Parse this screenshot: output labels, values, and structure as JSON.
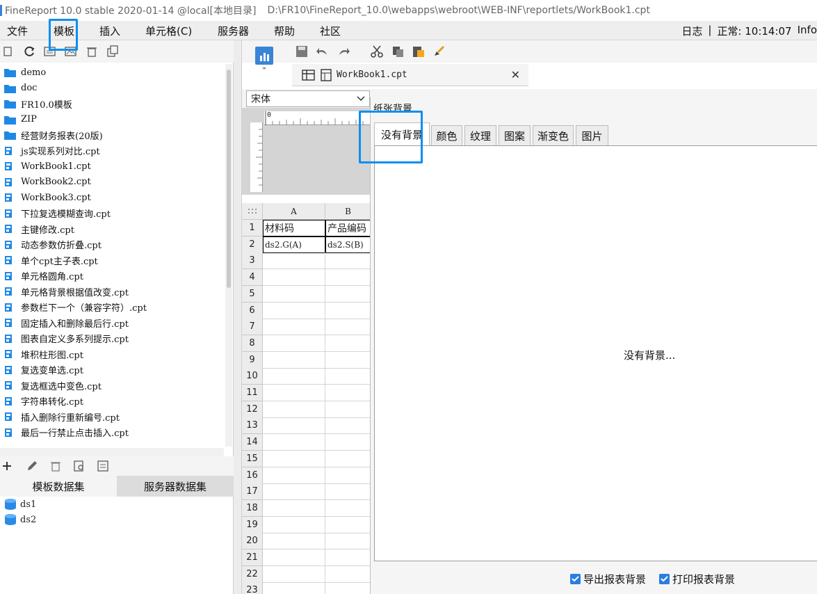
{
  "window": {
    "title": "FineReport 10.0 stable 2020-01-14 @local[本地目录]",
    "path": "D:\\FR10\\FineReport_10.0\\webapps\\webroot\\WEB-INF\\reportlets/WorkBook1.cpt"
  },
  "menu": {
    "items": [
      "文件",
      "模板",
      "插入",
      "单元格(C)",
      "服务器",
      "帮助",
      "社区"
    ],
    "status": [
      "日志",
      "|",
      "正常: 10:14:07",
      "Info"
    ]
  },
  "file_tree": {
    "items": [
      {
        "label": "demo",
        "type": "folder"
      },
      {
        "label": "doc",
        "type": "folder"
      },
      {
        "label": "FR10.0模板",
        "type": "folder"
      },
      {
        "label": "ZIP",
        "type": "folder"
      },
      {
        "label": "经营财务报表(20版)",
        "type": "folder"
      },
      {
        "label": "js实现系列对比.cpt",
        "type": "file"
      },
      {
        "label": "WorkBook1.cpt",
        "type": "file"
      },
      {
        "label": "WorkBook2.cpt",
        "type": "file"
      },
      {
        "label": "WorkBook3.cpt",
        "type": "file"
      },
      {
        "label": "下拉复选模糊查询.cpt",
        "type": "file"
      },
      {
        "label": "主键修改.cpt",
        "type": "file"
      },
      {
        "label": "动态参数仿折叠.cpt",
        "type": "file"
      },
      {
        "label": "单个cpt主子表.cpt",
        "type": "file"
      },
      {
        "label": "单元格圆角.cpt",
        "type": "file"
      },
      {
        "label": "单元格背景根据值改变.cpt",
        "type": "file"
      },
      {
        "label": "参数栏下一个（兼容字符）.cpt",
        "type": "file"
      },
      {
        "label": "固定插入和删除最后行.cpt",
        "type": "file"
      },
      {
        "label": "图表自定义多系列提示.cpt",
        "type": "file"
      },
      {
        "label": "堆积柱形图.cpt",
        "type": "file"
      },
      {
        "label": "复选变单选.cpt",
        "type": "file"
      },
      {
        "label": "复选框选中变色.cpt",
        "type": "file"
      },
      {
        "label": "字符串转化.cpt",
        "type": "file"
      },
      {
        "label": "插入删除行重新编号.cpt",
        "type": "file"
      },
      {
        "label": "最后一行禁止点击插入.cpt",
        "type": "file"
      }
    ]
  },
  "datasets": {
    "tabs": [
      "模板数据集",
      "服务器数据集"
    ],
    "items": [
      "ds1",
      "ds2"
    ]
  },
  "editor": {
    "tab_name": "WorkBook1.cpt",
    "font": "宋体",
    "ruler_label": "0",
    "columns": [
      "A",
      "B"
    ],
    "rows": [
      "1",
      "2",
      "3",
      "4",
      "5",
      "6",
      "7",
      "8",
      "9",
      "10",
      "11",
      "12",
      "13",
      "14",
      "15",
      "16",
      "17",
      "18",
      "19",
      "20",
      "21",
      "22",
      "23"
    ],
    "cells": {
      "A1": "材料码",
      "B1": "产品编码",
      "A2": "ds2.G(A)",
      "B2": "ds2.S(B)"
    }
  },
  "dialog": {
    "title": "纸张背景",
    "tabs": [
      "没有背景",
      "颜色",
      "纹理",
      "图案",
      "渐变色",
      "图片"
    ],
    "active_tab": "没有背景",
    "content_text": "没有背景...",
    "checkboxes": [
      {
        "label": "导出报表背景",
        "checked": true
      },
      {
        "label": "打印报表背景",
        "checked": true
      }
    ]
  },
  "colors": {
    "highlight": "#0d8ff0",
    "accent": "#2a7de1"
  }
}
